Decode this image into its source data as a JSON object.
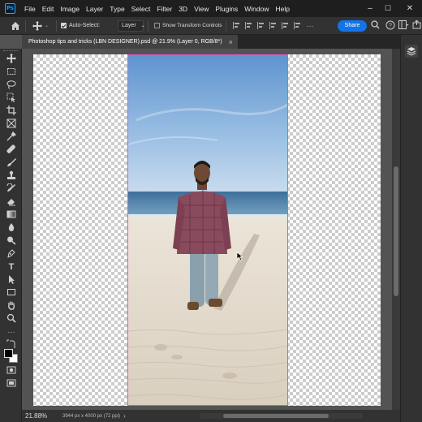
{
  "app": {
    "logo_text": "Ps"
  },
  "menu": [
    "File",
    "Edit",
    "Image",
    "Layer",
    "Type",
    "Select",
    "Filter",
    "3D",
    "View",
    "Plugins",
    "Window",
    "Help"
  ],
  "window_controls": {
    "minimize": "–",
    "maximize": "☐",
    "close": "✕"
  },
  "options_bar": {
    "auto_select_label": "Auto-Select:",
    "auto_select_checked": true,
    "auto_select_target": "Layer",
    "show_transform_label": "Show Transform Controls",
    "show_transform_checked": false,
    "share_label": "Share"
  },
  "document_tab": {
    "title": "Photoshop tips and tricks (LBN  DESIGNER).psd @ 21.9% (Layer 0, RGB/8*)",
    "close_glyph": "×"
  },
  "tools": [
    "move",
    "marquee",
    "lasso",
    "object-select",
    "crop",
    "frame",
    "eyedropper",
    "healing",
    "brush",
    "clone-stamp",
    "history-brush",
    "eraser",
    "gradient",
    "blur",
    "dodge",
    "pen",
    "type",
    "path-select",
    "shape",
    "hand",
    "zoom",
    "more",
    "swap-colors",
    "color-swatches",
    "quick-mask",
    "screen-mode",
    "artboard"
  ],
  "colors": {
    "foreground": "#000000",
    "background": "#ffffff",
    "accent": "#1473e6",
    "selection_border": "#d55cc8"
  },
  "status": {
    "zoom": "21.88%",
    "doc_info": "3944 px x 4000 px (72 ppi)"
  }
}
